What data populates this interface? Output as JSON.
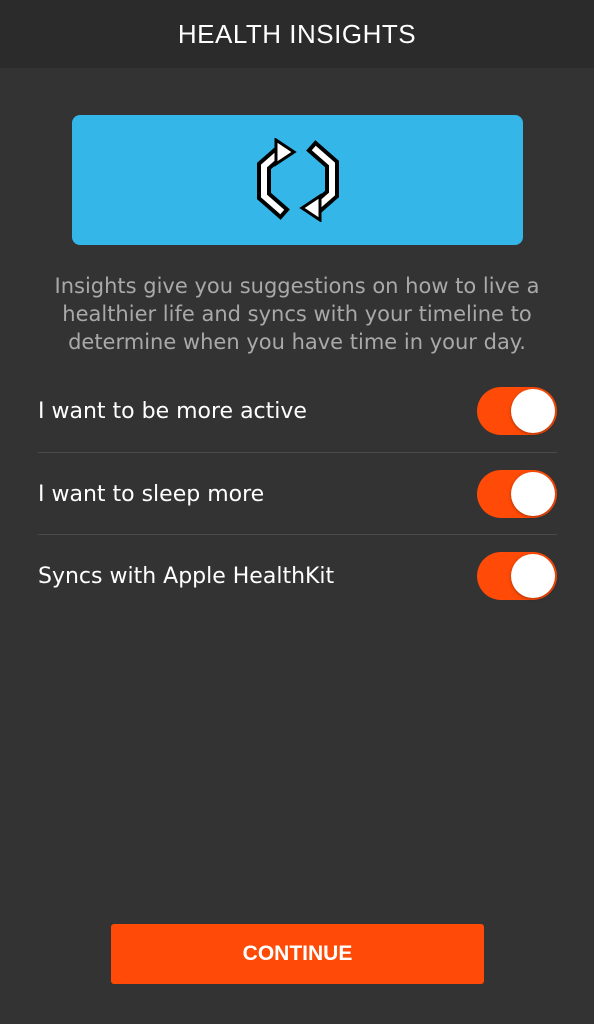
{
  "header": {
    "title": "HEALTH INSIGHTS"
  },
  "hero": {
    "icon": "sync-arrows-icon",
    "background_color": "#35b6e8"
  },
  "description": "Insights give you suggestions on how to live a healthier life and syncs with your timeline to determine when you have time in your day.",
  "toggles": [
    {
      "label": "I want to be more active",
      "on": true
    },
    {
      "label": "I want to sleep more",
      "on": true
    },
    {
      "label": "Syncs with Apple HealthKit",
      "on": true
    }
  ],
  "continue": {
    "label": "CONTINUE"
  },
  "colors": {
    "accent": "#ff4b07",
    "background": "#333333",
    "header_background": "#2b2b2b"
  }
}
